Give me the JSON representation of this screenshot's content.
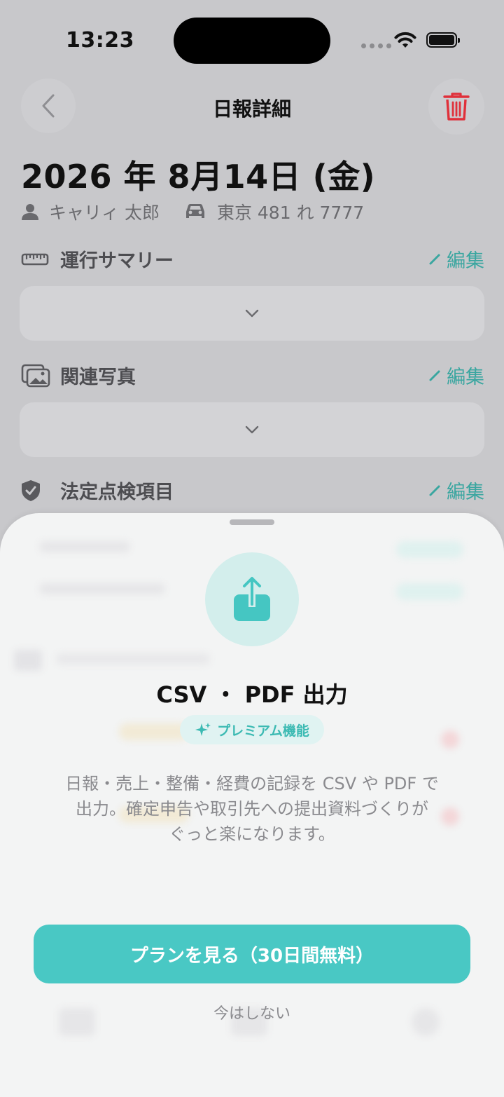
{
  "status": {
    "time": "13:23"
  },
  "nav": {
    "title": "日報詳細"
  },
  "header": {
    "date": "2026 年 8月14日 (金)",
    "driver": "キャリィ 太郎",
    "vehicle": "東京 481 れ 7777"
  },
  "sections": [
    {
      "title": "運行サマリー",
      "edit": "編集"
    },
    {
      "title": "関連写真",
      "edit": "編集"
    },
    {
      "title": "法定点検項目",
      "edit": "編集"
    }
  ],
  "sheet": {
    "title": "CSV ・ PDF 出力",
    "badge": "プレミアム機能",
    "desc_line1": "日報・売上・整備・経費の記録を CSV や PDF で",
    "desc_line2": "出力。確定申告や取引先への提出資料づくりが",
    "desc_line3": "ぐっと楽になります。",
    "cta": "プランを見る（30日間無料）",
    "dismiss": "今はしない"
  },
  "colors": {
    "accent": "#49c8c4",
    "danger": "#e0303a",
    "edit": "#3aa6a0"
  }
}
